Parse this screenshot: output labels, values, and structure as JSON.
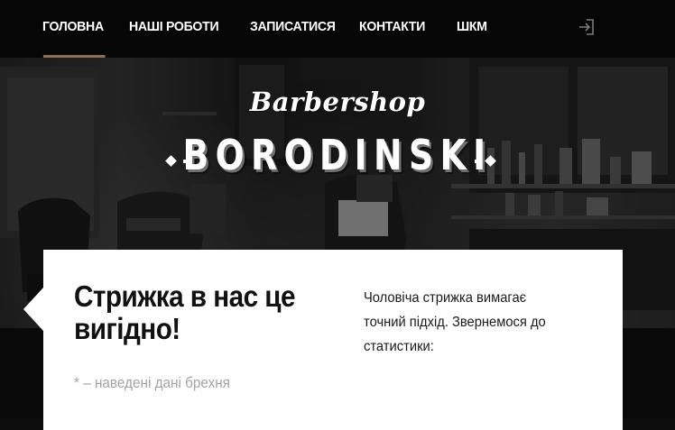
{
  "nav": {
    "items": [
      {
        "label": "ГОЛОВНА",
        "active": true
      },
      {
        "label": "НАШІ РОБОТИ",
        "active": false
      },
      {
        "label": "ЗАПИСАТИСЯ",
        "active": false
      },
      {
        "label": "КОНТАКТИ",
        "active": false
      },
      {
        "label": "ШКМ",
        "active": false
      }
    ],
    "login_icon": "login-icon",
    "active_underline_color": "#8f6e59"
  },
  "hero": {
    "script_title": "Barbershop",
    "main_title": "BORODINSKI",
    "ornament_icon": "diamond-ornament-icon"
  },
  "card": {
    "heading": "Стрижка в нас це вигідно!",
    "note": "* – наведені дані брехня",
    "text": "Чоловіча стрижка вимагає точний підхід. Звернемося до статистики:"
  }
}
